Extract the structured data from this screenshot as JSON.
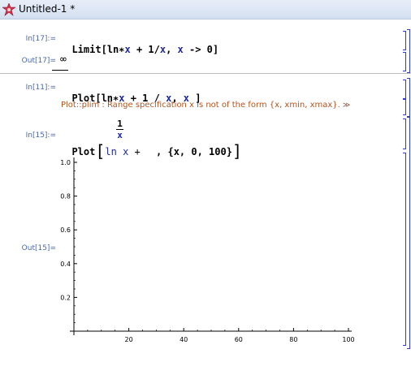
{
  "window": {
    "title": "Untitled-1 *"
  },
  "cells": {
    "in17_label": "In[17]:=",
    "in17_code": {
      "head": "Limit[",
      "fn": "ln",
      "op1": "∗",
      "v1": "x",
      "rest1": " + 1/",
      "v2": "x",
      "rest2": ", ",
      "v3": "x",
      "rest3": " -> 0]"
    },
    "out17_label": "Out[17]=",
    "out17_value": "∞",
    "in11_label": "In[11]:=",
    "in11_code": {
      "head": "Plot[",
      "fn": "ln",
      "op1": "∗",
      "v1": "x",
      "rest1": " + 1 / ",
      "v2": "x",
      "rest2": ", ",
      "v3": "x",
      "rest3": " ]"
    },
    "message": {
      "text": "Plot::plim :  Range specification x is not of the form {x, xmin, xmax}.",
      "link": "≫"
    },
    "in15_label": "In[15]:=",
    "in15_code": {
      "head": "Plot",
      "fn": "ln",
      "v1": "x",
      "plus": " + ",
      "numerator": "1",
      "denominator": "x",
      "tail": ", {x, 0, 100}"
    },
    "out15_label": "Out[15]="
  },
  "chart_data": {
    "type": "line",
    "series": [],
    "xlim": [
      0,
      100
    ],
    "ylim": [
      0,
      1.0
    ],
    "xticks": [
      20,
      40,
      60,
      80,
      100
    ],
    "yticks": [
      0.2,
      0.4,
      0.6,
      0.8,
      1.0
    ],
    "xtick_labels": [
      "20",
      "40",
      "60",
      "80",
      "100"
    ],
    "ytick_labels": [
      "0.2",
      "0.4",
      "0.6",
      "0.8",
      "1.0"
    ],
    "grid": false
  }
}
